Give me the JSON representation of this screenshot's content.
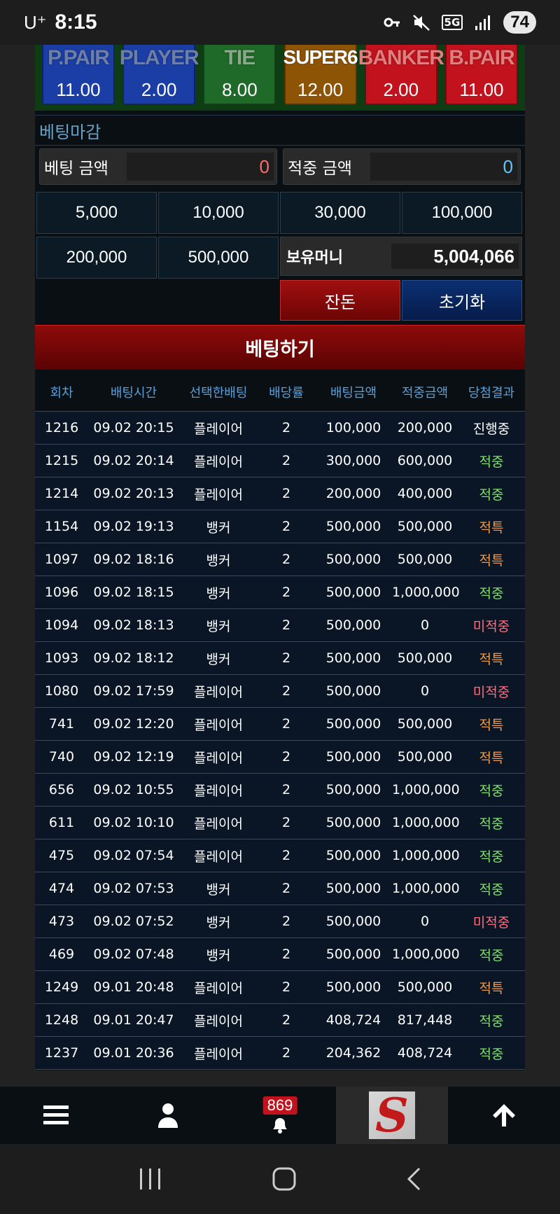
{
  "status_bar": {
    "carrier": "U⁺",
    "time": "8:15",
    "network": "5G",
    "battery": "74"
  },
  "bet_types": [
    {
      "name": "P.PAIR",
      "odds": "11.00",
      "color": "#1a3ea6"
    },
    {
      "name": "PLAYER",
      "odds": "2.00",
      "color": "#1a3ea6"
    },
    {
      "name": "TIE",
      "odds": "8.00",
      "color": "#1f6a28"
    },
    {
      "name": "SUPER6",
      "odds": "12.00",
      "color": "#8e5406"
    },
    {
      "name": "BANKER",
      "odds": "2.00",
      "color": "#c2121d"
    },
    {
      "name": "B.PAIR",
      "odds": "11.00",
      "color": "#c2121d"
    }
  ],
  "deadline_label": "베팅마감",
  "bet_amount": {
    "label": "베팅 금액",
    "value": "0"
  },
  "win_amount": {
    "label": "적중 금액",
    "value": "0"
  },
  "chips": [
    "5,000",
    "10,000",
    "30,000",
    "100,000",
    "200,000",
    "500,000"
  ],
  "balance": {
    "label": "보유머니",
    "value": "5,004,066"
  },
  "buttons": {
    "rest": "잔돈",
    "reset": "초기화",
    "place_bet": "베팅하기"
  },
  "history": {
    "headers": [
      "회차",
      "배팅시간",
      "선택한배팅",
      "배당률",
      "배팅금액",
      "적중금액",
      "당첨결과"
    ],
    "rows": [
      {
        "round": "1216",
        "time": "09.02 20:15",
        "pick": "플레이어",
        "odds": "2",
        "bet": "100,000",
        "win": "200,000",
        "result": "진행중",
        "status": "prog"
      },
      {
        "round": "1215",
        "time": "09.02 20:14",
        "pick": "플레이어",
        "odds": "2",
        "bet": "300,000",
        "win": "600,000",
        "result": "적중",
        "status": "win"
      },
      {
        "round": "1214",
        "time": "09.02 20:13",
        "pick": "플레이어",
        "odds": "2",
        "bet": "200,000",
        "win": "400,000",
        "result": "적중",
        "status": "win"
      },
      {
        "round": "1154",
        "time": "09.02 19:13",
        "pick": "뱅커",
        "odds": "2",
        "bet": "500,000",
        "win": "500,000",
        "result": "적특",
        "status": "tie"
      },
      {
        "round": "1097",
        "time": "09.02 18:16",
        "pick": "뱅커",
        "odds": "2",
        "bet": "500,000",
        "win": "500,000",
        "result": "적특",
        "status": "tie"
      },
      {
        "round": "1096",
        "time": "09.02 18:15",
        "pick": "뱅커",
        "odds": "2",
        "bet": "500,000",
        "win": "1,000,000",
        "result": "적중",
        "status": "win"
      },
      {
        "round": "1094",
        "time": "09.02 18:13",
        "pick": "뱅커",
        "odds": "2",
        "bet": "500,000",
        "win": "0",
        "result": "미적중",
        "status": "lose"
      },
      {
        "round": "1093",
        "time": "09.02 18:12",
        "pick": "뱅커",
        "odds": "2",
        "bet": "500,000",
        "win": "500,000",
        "result": "적특",
        "status": "tie"
      },
      {
        "round": "1080",
        "time": "09.02 17:59",
        "pick": "플레이어",
        "odds": "2",
        "bet": "500,000",
        "win": "0",
        "result": "미적중",
        "status": "lose"
      },
      {
        "round": "741",
        "time": "09.02 12:20",
        "pick": "플레이어",
        "odds": "2",
        "bet": "500,000",
        "win": "500,000",
        "result": "적특",
        "status": "tie"
      },
      {
        "round": "740",
        "time": "09.02 12:19",
        "pick": "플레이어",
        "odds": "2",
        "bet": "500,000",
        "win": "500,000",
        "result": "적특",
        "status": "tie"
      },
      {
        "round": "656",
        "time": "09.02 10:55",
        "pick": "플레이어",
        "odds": "2",
        "bet": "500,000",
        "win": "1,000,000",
        "result": "적중",
        "status": "win"
      },
      {
        "round": "611",
        "time": "09.02 10:10",
        "pick": "플레이어",
        "odds": "2",
        "bet": "500,000",
        "win": "1,000,000",
        "result": "적중",
        "status": "win"
      },
      {
        "round": "475",
        "time": "09.02 07:54",
        "pick": "플레이어",
        "odds": "2",
        "bet": "500,000",
        "win": "1,000,000",
        "result": "적중",
        "status": "win"
      },
      {
        "round": "474",
        "time": "09.02 07:53",
        "pick": "뱅커",
        "odds": "2",
        "bet": "500,000",
        "win": "1,000,000",
        "result": "적중",
        "status": "win"
      },
      {
        "round": "473",
        "time": "09.02 07:52",
        "pick": "뱅커",
        "odds": "2",
        "bet": "500,000",
        "win": "0",
        "result": "미적중",
        "status": "lose"
      },
      {
        "round": "469",
        "time": "09.02 07:48",
        "pick": "뱅커",
        "odds": "2",
        "bet": "500,000",
        "win": "1,000,000",
        "result": "적중",
        "status": "win"
      },
      {
        "round": "1249",
        "time": "09.01 20:48",
        "pick": "플레이어",
        "odds": "2",
        "bet": "500,000",
        "win": "500,000",
        "result": "적특",
        "status": "tie"
      },
      {
        "round": "1248",
        "time": "09.01 20:47",
        "pick": "플레이어",
        "odds": "2",
        "bet": "408,724",
        "win": "817,448",
        "result": "적중",
        "status": "win"
      },
      {
        "round": "1237",
        "time": "09.01 20:36",
        "pick": "플레이어",
        "odds": "2",
        "bet": "204,362",
        "win": "408,724",
        "result": "적중",
        "status": "win"
      }
    ]
  },
  "bottom_nav": {
    "items": [
      "menu-icon",
      "user-icon",
      "bell-icon",
      "logo",
      "arrow-up-icon"
    ],
    "notification_count": "869",
    "logo_letter": "S"
  },
  "android_nav": [
    "recent-apps-icon",
    "home-icon",
    "back-icon"
  ]
}
